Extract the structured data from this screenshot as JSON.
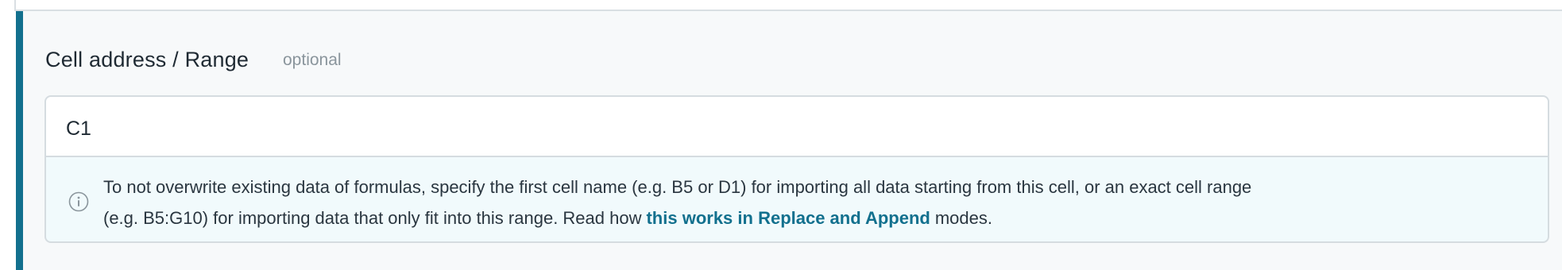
{
  "field": {
    "label": "Cell address / Range",
    "optional_label": "optional",
    "value": "C1"
  },
  "hint": {
    "line1": "To not overwrite existing data of formulas, specify the first cell name (e.g. B5 or D1) for importing all data starting from this cell, or an exact cell range",
    "line2_prefix": "(e.g. B5:G10) for importing data that only fit into this range. Read how",
    "link_text": "this works in Replace and Append",
    "line2_suffix": "modes.",
    "icon": "info-icon"
  },
  "colors": {
    "accent": "#12708e",
    "link": "#12708e",
    "panel_bg": "#f7f9fa",
    "hint_bg": "#f1fafc"
  }
}
